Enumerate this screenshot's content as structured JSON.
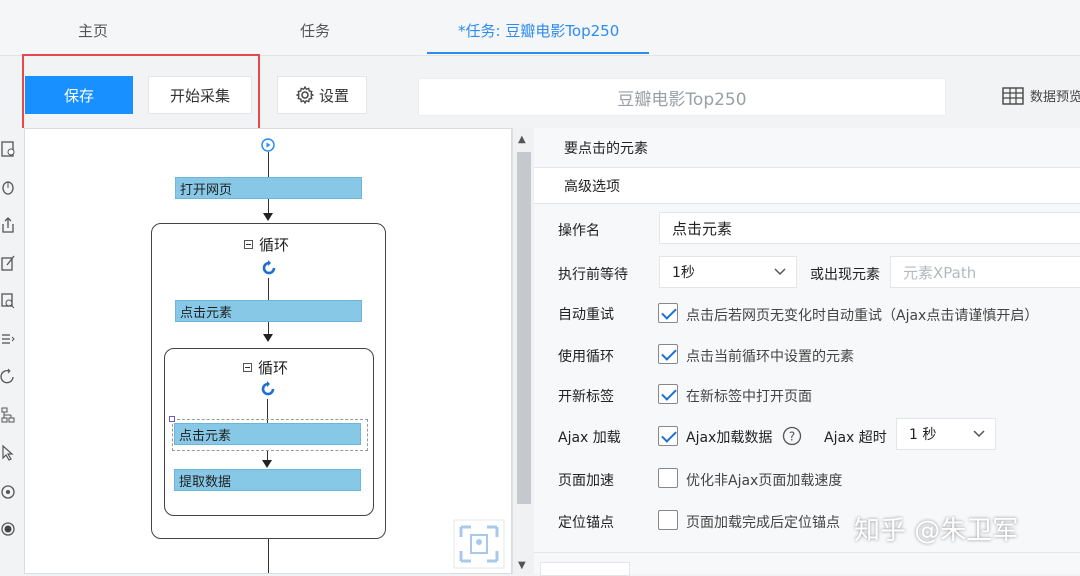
{
  "tabs": [
    {
      "label": "主页",
      "active": false
    },
    {
      "label": "任务",
      "active": false
    },
    {
      "label": "*任务: 豆瓣电影Top250",
      "active": true
    }
  ],
  "toolbar": {
    "save_label": "保存",
    "start_label": "开始采集",
    "settings_label": "设置",
    "task_name": "豆瓣电影Top250",
    "preview_label": "数据预览"
  },
  "workflow": {
    "open_page": "打开网页",
    "loop1_title": "循环",
    "click1": "点击元素",
    "loop2_title": "循环",
    "click2": "点击元素",
    "extract": "提取数据"
  },
  "panel": {
    "section1": "要点击的元素",
    "section2": "高级选项",
    "op_name_label": "操作名",
    "op_name_value": "点击元素",
    "wait_label": "执行前等待",
    "wait_value": "1秒",
    "appear_label": "或出现元素",
    "xpath_placeholder": "元素XPath",
    "retry_label": "自动重试",
    "retry_text": "点击后若网页无变化时自动重试（Ajax点击请谨慎开启）",
    "loop_label": "使用循环",
    "loop_text": "点击当前循环中设置的元素",
    "newtab_label": "开新标签",
    "newtab_text": "在新标签中打开页面",
    "ajax_label": "Ajax 加载",
    "ajax_text": "Ajax加载数据",
    "ajax_timeout_label": "Ajax 超时",
    "ajax_timeout_value": "1 秒",
    "speed_label": "页面加速",
    "speed_text": "优化非Ajax页面加载速度",
    "anchor_label": "定位锚点",
    "anchor_text": "页面加载完成后定位锚点"
  },
  "watermark": "知乎 @朱卫军",
  "colors": {
    "accent": "#1890ff",
    "step_fill": "#86c8e6",
    "highlight": "#e8474c"
  }
}
